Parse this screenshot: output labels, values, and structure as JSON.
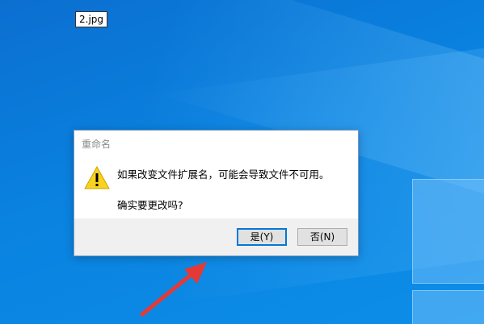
{
  "desktop": {
    "file_label": "2.jpg"
  },
  "dialog": {
    "title": "重命名",
    "message_line1": "如果改变文件扩展名，可能会导致文件不可用。",
    "message_line2": "确实要更改吗?",
    "buttons": {
      "yes_label": "是(Y)",
      "no_label": "否(N)"
    },
    "icon": "warning-triangle-icon"
  },
  "annotation": {
    "arrow_color": "#e53935"
  }
}
